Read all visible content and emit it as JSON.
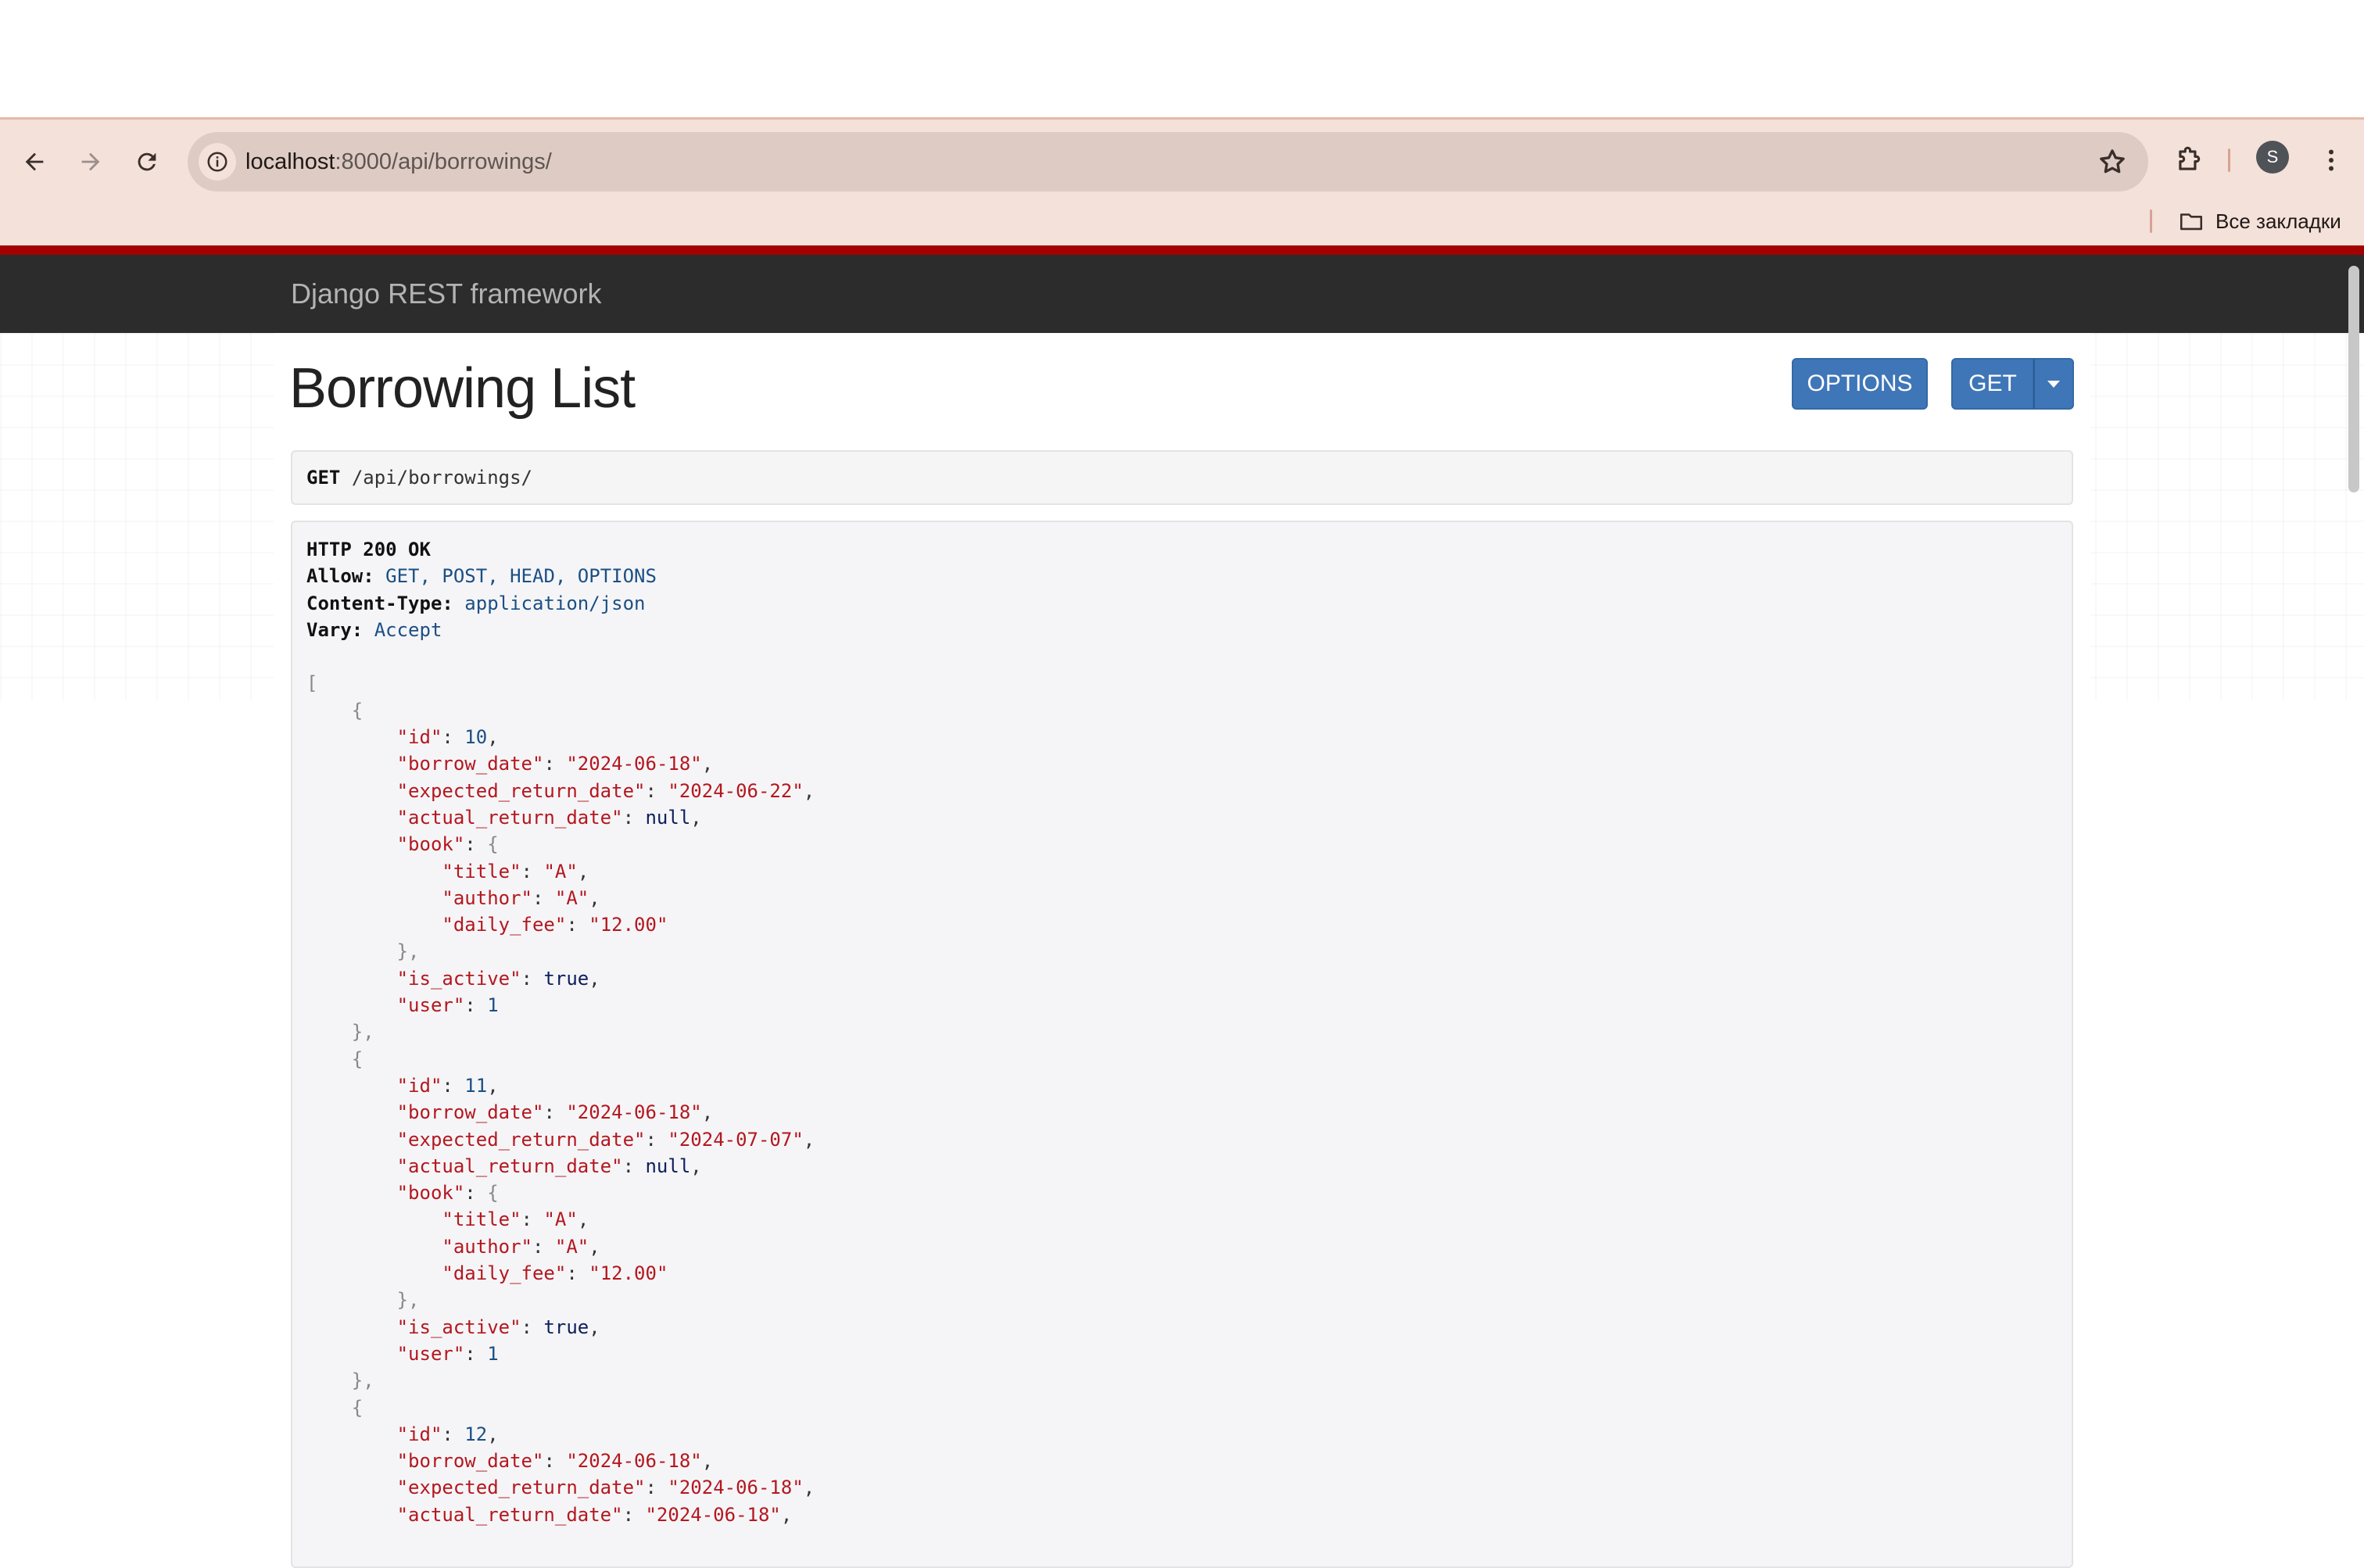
{
  "browser": {
    "url_host": "localhost",
    "url_path": ":8000/api/borrowings/",
    "bookmarks_label": "Все закладки",
    "profile_initial": "S"
  },
  "navbar": {
    "brand": "Django REST framework"
  },
  "page": {
    "title": "Borrowing List",
    "options_button": "OPTIONS",
    "get_button": "GET"
  },
  "request": {
    "method": "GET",
    "path_prefix": "/api/",
    "path_resource": "borrowings/"
  },
  "response": {
    "status": "HTTP 200 OK",
    "headers": [
      {
        "name": "Allow:",
        "value": "GET, POST, HEAD, OPTIONS"
      },
      {
        "name": "Content-Type:",
        "value": "application/json"
      },
      {
        "name": "Vary:",
        "value": "Accept"
      }
    ],
    "items": [
      {
        "id": "10",
        "borrow_date": "\"2024-06-18\"",
        "expected_return_date": "\"2024-06-22\"",
        "actual_return_date": "null",
        "book_title": "\"A\"",
        "book_author": "\"A\"",
        "book_daily_fee": "\"12.00\"",
        "is_active": "true",
        "user": "1"
      },
      {
        "id": "11",
        "borrow_date": "\"2024-06-18\"",
        "expected_return_date": "\"2024-07-07\"",
        "actual_return_date": "null",
        "book_title": "\"A\"",
        "book_author": "\"A\"",
        "book_daily_fee": "\"12.00\"",
        "is_active": "true",
        "user": "1"
      },
      {
        "id": "12",
        "borrow_date": "\"2024-06-18\"",
        "expected_return_date": "\"2024-06-18\"",
        "actual_return_date": "\"2024-06-18\""
      }
    ]
  }
}
